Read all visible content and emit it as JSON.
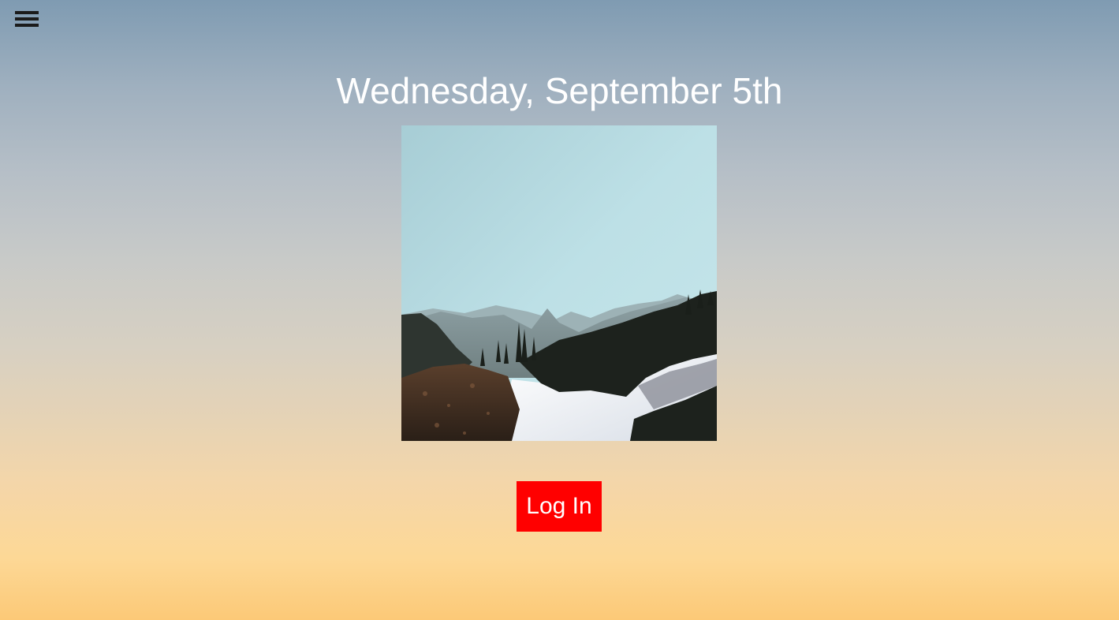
{
  "menu": {
    "icon": "hamburger-menu-icon"
  },
  "header": {
    "date_title": "Wednesday, September 5th"
  },
  "photo": {
    "subject": "mountain-landscape-image"
  },
  "actions": {
    "login_label": "Log In"
  },
  "colors": {
    "title_text": "#ffffff",
    "login_button_bg": "#ff0000",
    "login_button_text": "#ffffff",
    "menu_icon": "#1b1b1b"
  }
}
